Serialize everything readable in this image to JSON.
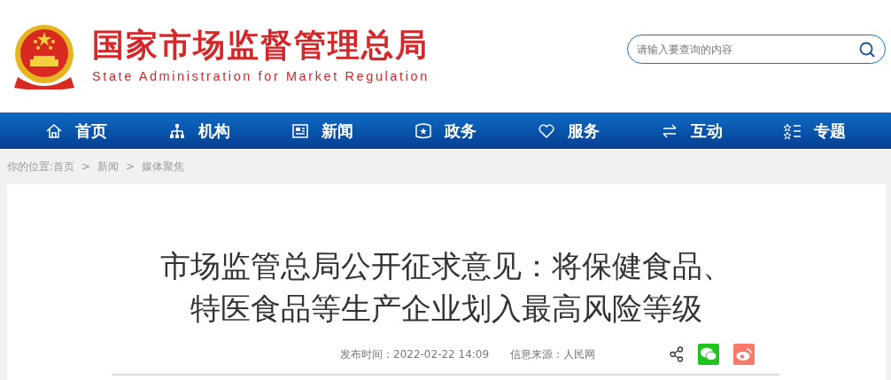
{
  "header": {
    "title": "国家市场监督管理总局",
    "subtitle": "State Administration for Market Regulation",
    "search": {
      "placeholder": "请输入要查询的内容"
    }
  },
  "nav": [
    {
      "label": "首页",
      "kind": "home"
    },
    {
      "label": "机构",
      "kind": "org"
    },
    {
      "label": "新闻",
      "kind": "news"
    },
    {
      "label": "政务",
      "kind": "gov"
    },
    {
      "label": "服务",
      "kind": "service"
    },
    {
      "label": "互动",
      "kind": "interact"
    },
    {
      "label": "专题",
      "kind": "topic"
    }
  ],
  "breadcrumb": {
    "prefix": "你的位置:",
    "separator": ">",
    "items": [
      "首页",
      "新闻",
      "媒体聚焦"
    ]
  },
  "article": {
    "title_lines": [
      "市场监管总局公开征求意见：将保健食品、",
      "特医食品等生产企业划入最高风险等级"
    ],
    "published": "发布时间：2022-02-22 14:09",
    "source": "信息来源：人民网",
    "share": [
      {
        "kind": "share"
      },
      {
        "kind": "wechat"
      },
      {
        "kind": "weibo"
      }
    ]
  }
}
